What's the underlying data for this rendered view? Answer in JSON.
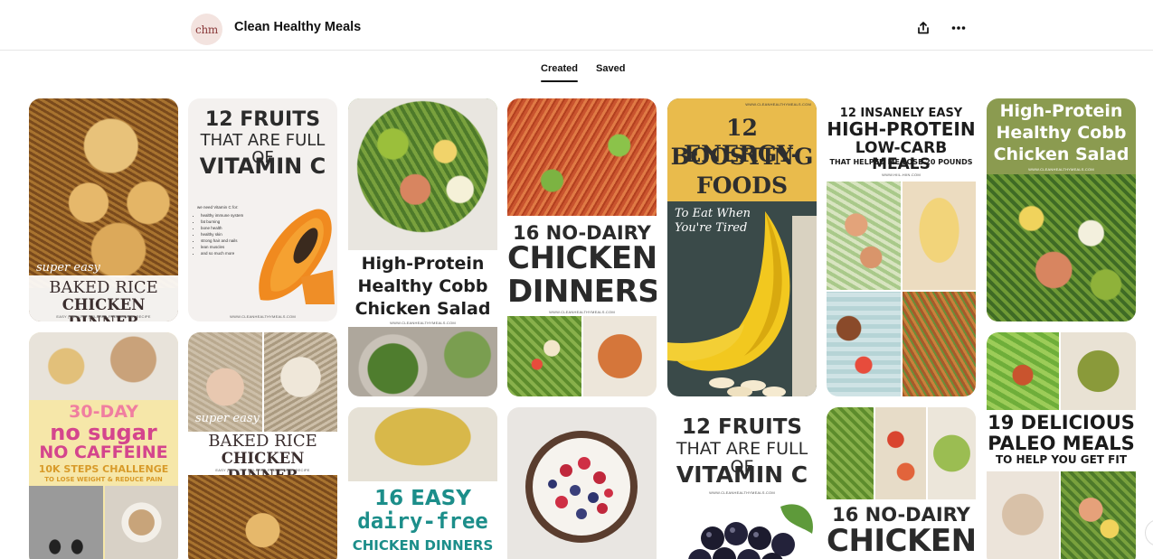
{
  "header": {
    "avatar_initials": "chm",
    "board_title": "Clean Healthy Meals",
    "share_icon": "share-icon",
    "more_icon": "more-horizontal-icon"
  },
  "tabs": [
    {
      "label": "Created",
      "active": true
    },
    {
      "label": "Saved",
      "active": false
    }
  ],
  "pins": {
    "p1": {
      "small": "super easy",
      "l1": "BAKED RICE",
      "l2": "CHICKEN DINNER",
      "sub": "EASY | HEALTHY | GLUTEN-FREE DINNER RECIPE"
    },
    "p2": {
      "l1": "12 FRUITS",
      "l2": "THAT ARE FULL OF",
      "l3": "VITAMIN C",
      "list_title": "we need Vitamin C for:",
      "bullets": [
        "healthy immune system",
        "fat burning",
        "bone health",
        "healthy skin",
        "strong hair and nails",
        "lean muscles",
        "and so much more"
      ],
      "site": "WWW.CLEANHEALTHYMEALS.COM"
    },
    "p3": {
      "l1": "High-Protein",
      "l2": "Healthy Cobb",
      "l3": "Chicken Salad",
      "site": "WWW.CLEANHEALTHYMEALS.COM"
    },
    "p4": {
      "l1": "16 NO-DAIRY",
      "l2": "CHICKEN",
      "l3": "DINNERS",
      "site": "WWW.CLEANHEALTHYMEALS.COM"
    },
    "p5": {
      "site": "WWW.CLEANHEALTHYMEALS.COM",
      "l1": "12 ENERGY-",
      "l2": "BOOSTING",
      "l3": "FOODS",
      "sub1": "To Eat When",
      "sub2": "You're Tired"
    },
    "p6": {
      "l1": "12 INSANELY EASY",
      "l2": "HIGH-PROTEIN",
      "l3": "LOW-CARB MEALS",
      "l4": "THAT HELPED ME LOSE 20 POUNDS",
      "site": "WWW.HIIL-HIIN.COM"
    },
    "p7": {
      "l1": "High-Protein",
      "l2": "Healthy Cobb",
      "l3": "Chicken Salad",
      "site": "WWW.CLEANHEALTHYMEALS.COM"
    },
    "p8": {
      "l1": "30-DAY",
      "l2": "no sugar",
      "l3": "NO CAFFEINE",
      "l4": "10K STEPS CHALLENGE",
      "l5": "TO LOSE WEIGHT & REDUCE PAIN"
    },
    "p9": {
      "small": "super easy",
      "l1": "BAKED RICE",
      "l2": "CHICKEN DINNER",
      "sub": "EASY | HEALTHY | GLUTEN-FREE DINNER RECIPE"
    },
    "p10": {
      "l1": "16 EASY",
      "l2": "dairy-free",
      "l3": "CHICKEN DINNERS"
    },
    "p12": {
      "l1": "12 FRUITS",
      "l2": "THAT ARE FULL OF",
      "l3": "VITAMIN C",
      "site": "WWW.CLEANHEALTHYMEALS.COM"
    },
    "p13": {
      "l1": "16 NO-DAIRY",
      "l2": "CHICKEN"
    },
    "p14": {
      "l1": "19 DELICIOUS",
      "l2": "PALEO MEALS",
      "l3": "TO HELP YOU GET FIT"
    }
  },
  "colors": {
    "p5_banner": "#e9bb4c",
    "p5_body": "#3a4a49",
    "p7_banner": "#8b9b50",
    "p8_pink": "#d4458d",
    "p8_yellow": "#f6e7a9",
    "p10_teal": "#1c8e8a"
  }
}
